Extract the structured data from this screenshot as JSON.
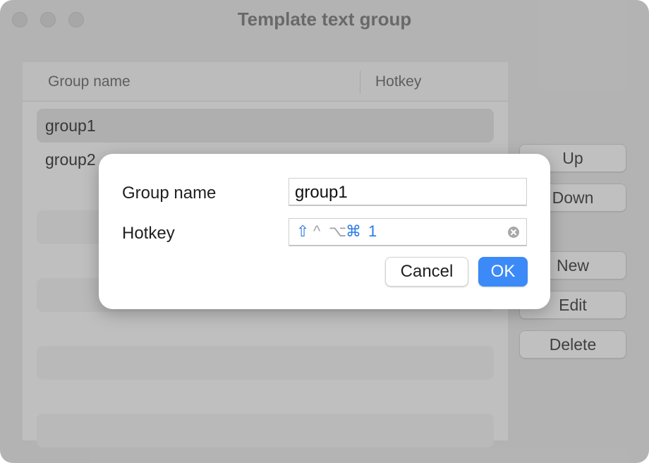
{
  "window": {
    "title": "Template text group"
  },
  "table": {
    "columns": [
      "Group name",
      "Hotkey"
    ],
    "rows": [
      {
        "name": "group1"
      },
      {
        "name": "group2"
      }
    ]
  },
  "side_buttons": {
    "up": "Up",
    "down": "Down",
    "new": "New",
    "edit": "Edit",
    "delete": "Delete"
  },
  "dialog": {
    "group_name_label": "Group name",
    "group_name_value": "group1",
    "hotkey_label": "Hotkey",
    "hotkey": {
      "shift": "⇧",
      "control": "^",
      "option": "⌥",
      "command": "⌘",
      "key": "1"
    },
    "cancel_label": "Cancel",
    "ok_label": "OK"
  },
  "colors": {
    "accent": "#3b8af7",
    "hotkey_active": "#2a79e6",
    "hotkey_inactive": "#a3a3a3"
  }
}
